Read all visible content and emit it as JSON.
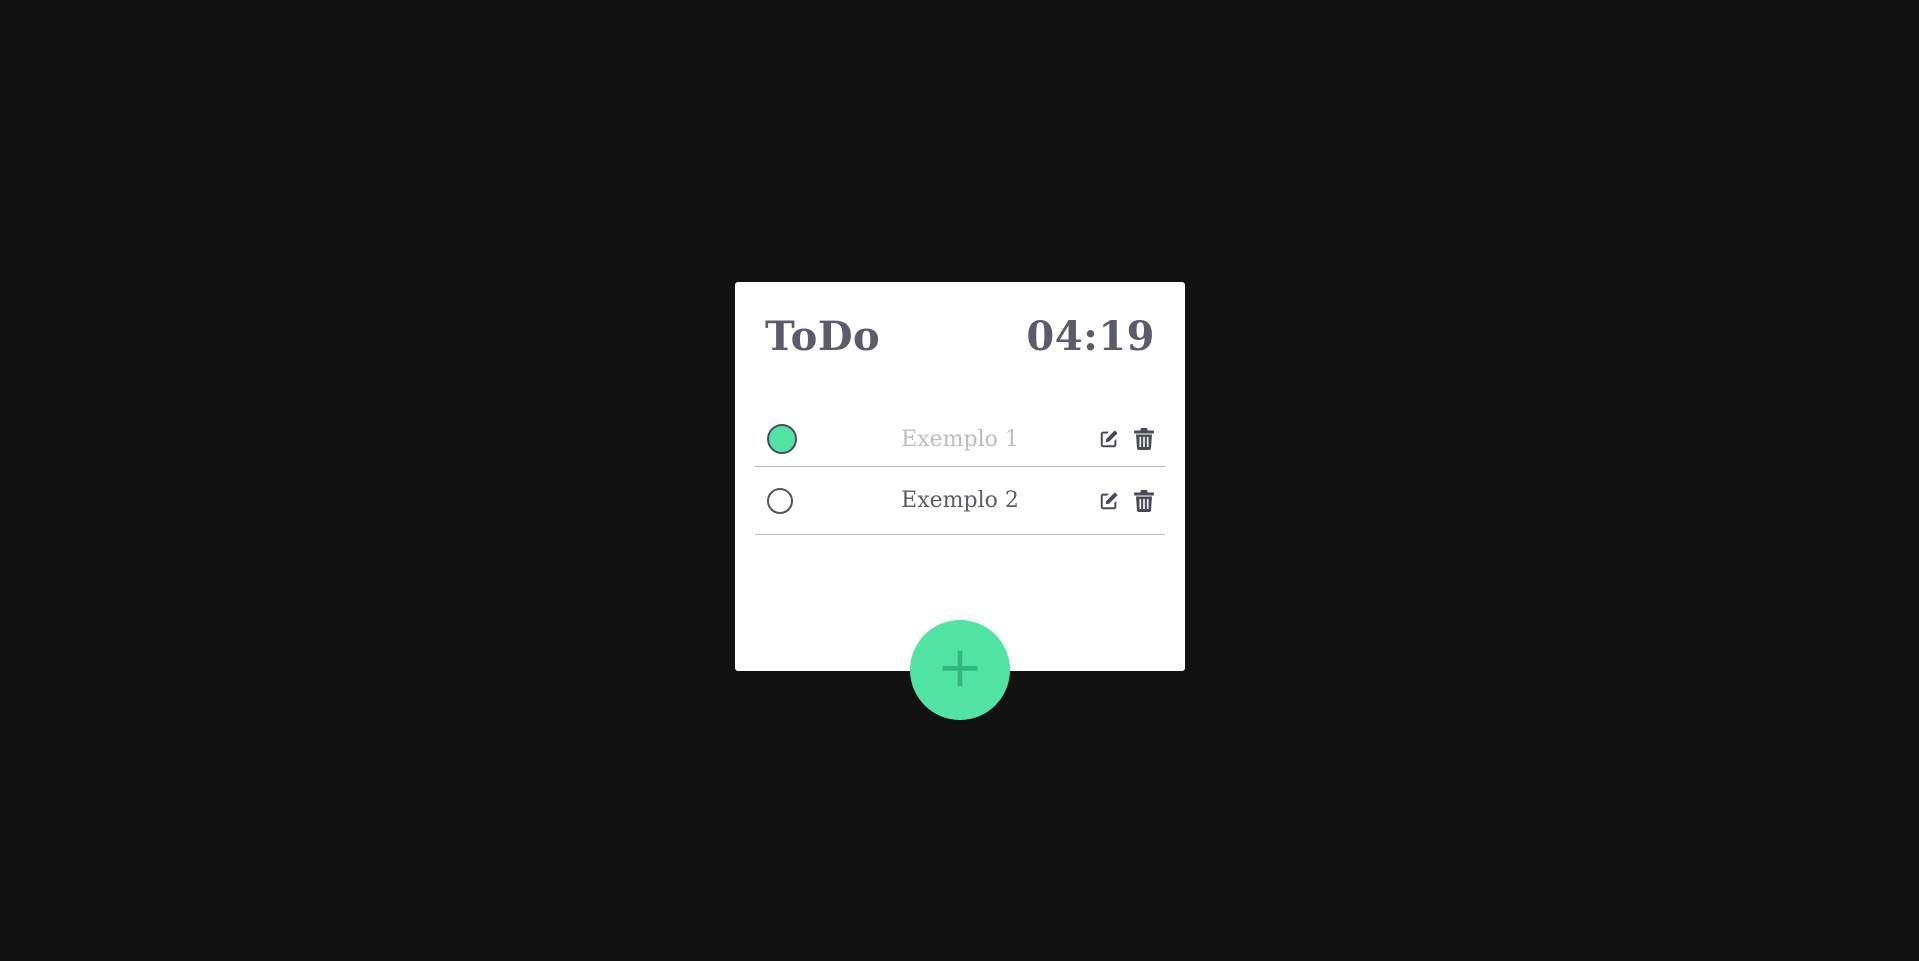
{
  "app": {
    "title": "ToDo",
    "time": "04:19"
  },
  "todos": [
    {
      "label": "Exemplo 1",
      "done": true,
      "edit_icon": "edit-icon",
      "delete_icon": "trash-icon"
    },
    {
      "label": "Exemplo 2",
      "done": false,
      "edit_icon": "edit-icon",
      "delete_icon": "trash-icon"
    }
  ],
  "fab": {
    "label": "+",
    "icon": "plus-icon"
  },
  "colors": {
    "background": "#121212",
    "card": "#ffffff",
    "accent": "#50e3a4",
    "text": "#5b5b6b",
    "done_text": "#bdbdbd"
  }
}
